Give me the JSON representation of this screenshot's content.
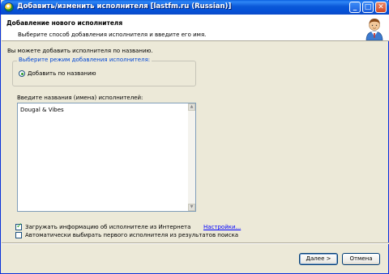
{
  "window": {
    "title": "Добавить/изменить исполнителя [lastfm.ru (Russian)]",
    "controls": {
      "minimize": "_",
      "maximize": "□",
      "close": "✕"
    }
  },
  "header": {
    "title": "Добавление нового исполнителя",
    "subtitle": "Выберите способ добавления исполнителя и введите его имя.",
    "icon": "user-avatar-icon"
  },
  "intro": "Вы можете добавить исполнителя по названию.",
  "mode_group": {
    "legend": "Выберите режим добавления исполнителя:",
    "options": [
      {
        "label": "Добавить по названию",
        "selected": true
      }
    ]
  },
  "names": {
    "label": "Введите названия (имена) исполнителей:",
    "value": "Dougal & Vibes"
  },
  "options": {
    "load_info": {
      "label": "Загружать информацию об исполнителе из Интернета",
      "checked": true
    },
    "auto_select": {
      "label": "Автоматически выбирать первого исполнителя из результатов поиска",
      "checked": false
    },
    "settings_link": "Настройки..."
  },
  "buttons": {
    "next": "Далее >",
    "cancel": "Отмена"
  },
  "colors": {
    "titlebar": "#0a58d8",
    "dialog_bg": "#ece9d8",
    "link": "#0000ff",
    "legend": "#0046d5"
  }
}
